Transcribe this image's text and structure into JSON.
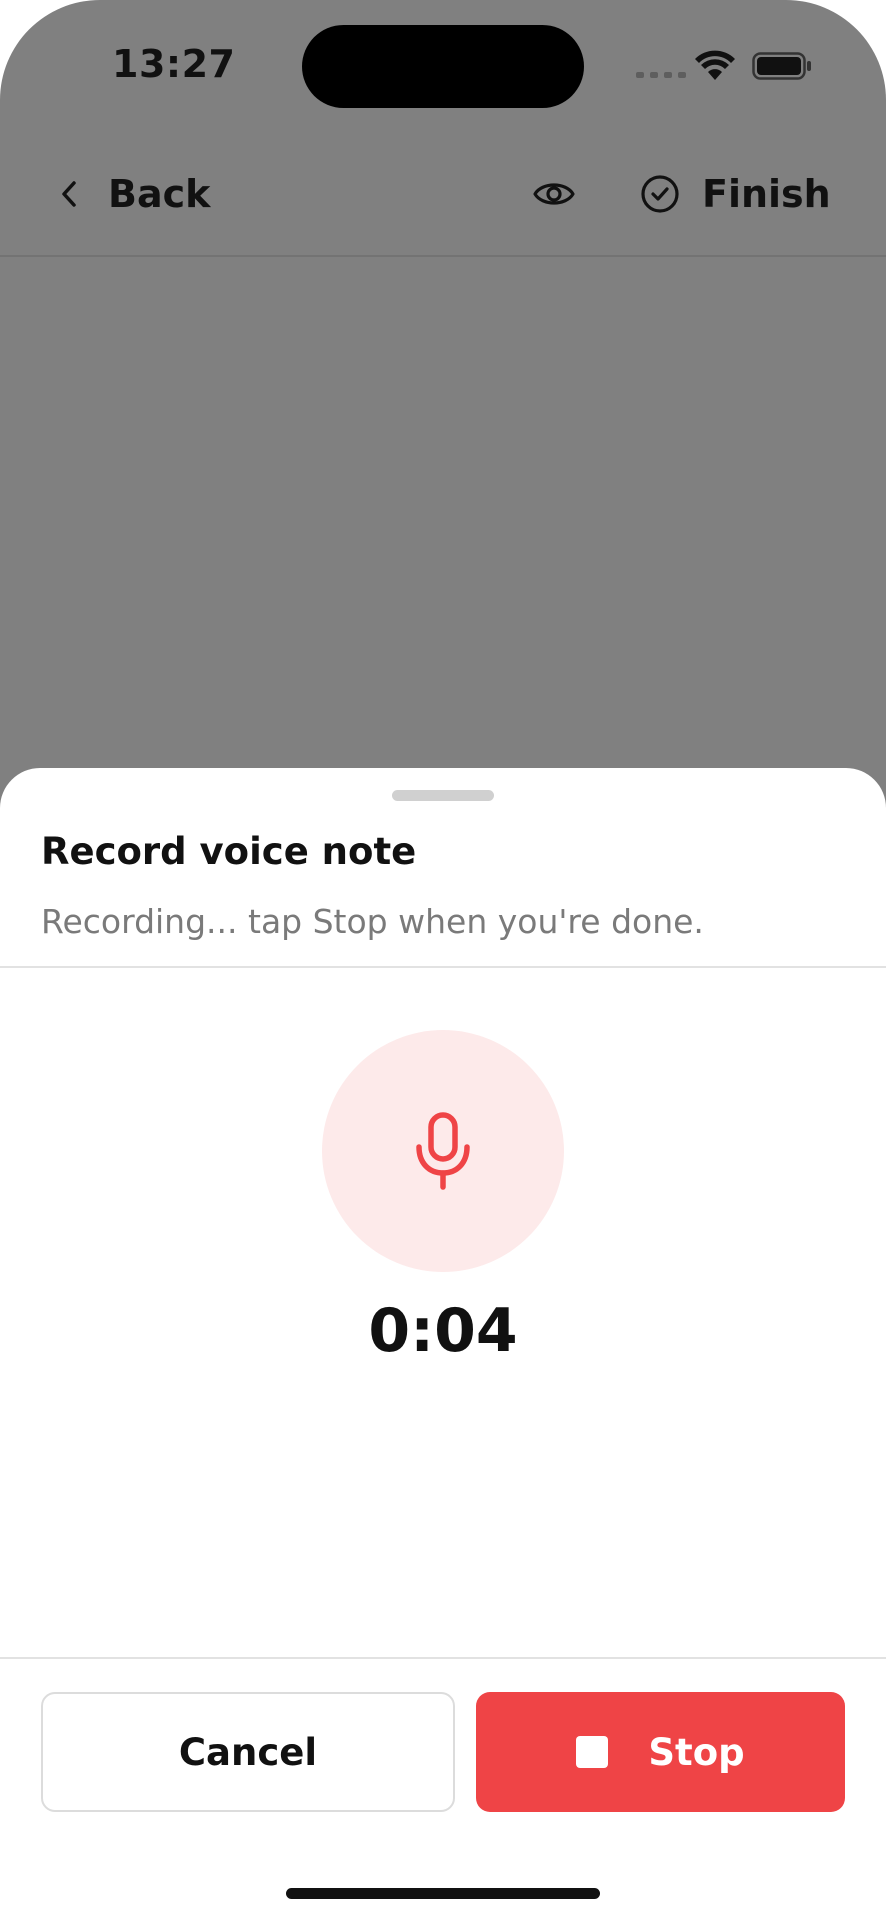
{
  "status_bar": {
    "time": "13:27"
  },
  "nav": {
    "back_label": "Back",
    "finish_label": "Finish",
    "icons": [
      "chevron-left-icon",
      "eye-icon",
      "check-circle-icon"
    ]
  },
  "sheet": {
    "title": "Record voice note",
    "subtitle": "Recording... tap Stop when you're done.",
    "timer": "0:04",
    "mic_icon": "microphone-icon",
    "cancel_label": "Cancel",
    "stop_label": "Stop",
    "stop_icon": "stop-square-icon"
  },
  "colors": {
    "backdrop": "#808080",
    "accent_red": "#ef4446",
    "mic_circle_bg": "#fdeaea",
    "text_primary": "#111111",
    "text_secondary": "#7a7a7a"
  }
}
